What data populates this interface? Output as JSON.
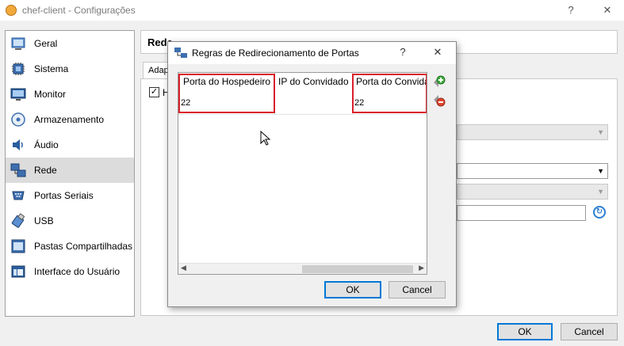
{
  "window": {
    "title": "chef-client - Configurações",
    "help": "?",
    "close": "✕"
  },
  "sidebar": {
    "items": [
      {
        "label": "Geral",
        "icon": "general-icon"
      },
      {
        "label": "Sistema",
        "icon": "system-chip-icon"
      },
      {
        "label": "Monitor",
        "icon": "monitor-icon"
      },
      {
        "label": "Armazenamento",
        "icon": "storage-disk-icon"
      },
      {
        "label": "Áudio",
        "icon": "speaker-icon"
      },
      {
        "label": "Rede",
        "icon": "network-icon",
        "selected": true
      },
      {
        "label": "Portas Seriais",
        "icon": "serial-port-icon"
      },
      {
        "label": "USB",
        "icon": "usb-icon"
      },
      {
        "label": "Pastas Compartilhadas",
        "icon": "shared-folder-icon"
      },
      {
        "label": "Interface do Usuário",
        "icon": "user-interface-icon"
      }
    ]
  },
  "content": {
    "header": "Rede",
    "tab": "Adap",
    "checkbox_label": "H",
    "checkbox_checked": true
  },
  "footer": {
    "ok": "OK",
    "cancel": "Cancel"
  },
  "dialog": {
    "title": "Regras de Redirecionamento de Portas",
    "help": "?",
    "close": "✕",
    "columns": [
      "Porta do Hospedeiro",
      "IP do Convidado",
      "Porta do Convida"
    ],
    "rows": [
      {
        "host_port": "22",
        "guest_ip": "",
        "guest_port": "22"
      }
    ],
    "ok": "OK",
    "cancel": "Cancel",
    "add_rule_icon": "add-rule-icon",
    "remove_rule_icon": "remove-rule-icon",
    "highlight_color": "#d9202a"
  }
}
